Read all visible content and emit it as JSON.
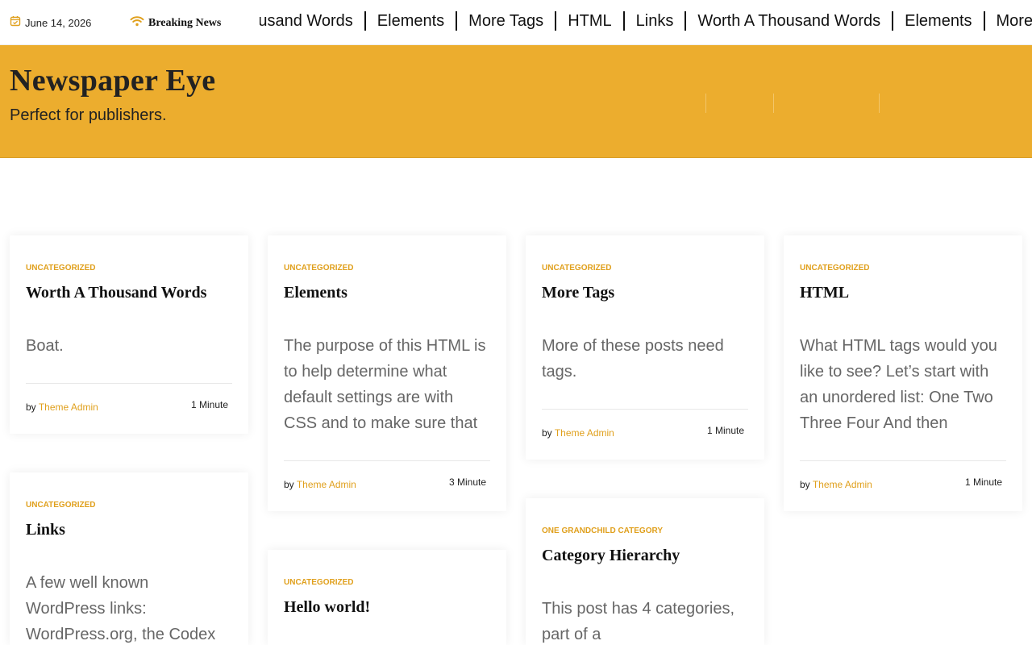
{
  "topbar": {
    "date": "June 14, 2026",
    "breaking_label": "Breaking News",
    "ticker": [
      "Worth A Thousand Words",
      "Elements",
      "More Tags",
      "HTML",
      "Links",
      "Worth A Thousand Words",
      "Elements",
      "More"
    ]
  },
  "header": {
    "site_title": "Newspaper Eye",
    "tagline": "Perfect for publishers."
  },
  "posts": [
    {
      "category": "Uncategorized",
      "title": "Worth A Thousand Words",
      "excerpt": "Boat.",
      "by": "by",
      "author": "Theme Admin",
      "read_time": "1 Minute"
    },
    {
      "category": "Uncategorized",
      "title": "Elements",
      "excerpt": "The purpose of this HTML is to help determine what default settings are with CSS and to make sure that",
      "by": "by",
      "author": "Theme Admin",
      "read_time": "3 Minute"
    },
    {
      "category": "Uncategorized",
      "title": "More Tags",
      "excerpt": "More of these posts need tags.",
      "by": "by",
      "author": "Theme Admin",
      "read_time": "1 Minute"
    },
    {
      "category": "Uncategorized",
      "title": "HTML",
      "excerpt": "What HTML tags would you like to see? Let’s start with an unordered list: One Two Three Four And then",
      "by": "by",
      "author": "Theme Admin",
      "read_time": "1 Minute"
    },
    {
      "category": "Uncategorized",
      "title": "Links",
      "excerpt": "A few well known WordPress links: WordPress.org, the Codex"
    },
    {
      "category": "Uncategorized",
      "title": "Hello world!"
    },
    {
      "category": "One Grandchild Category",
      "title": "Category Hierarchy",
      "excerpt": "This post has 4 categories, part of a"
    }
  ],
  "colors": {
    "accent": "#ecad2e",
    "link": "#e0a01d"
  }
}
